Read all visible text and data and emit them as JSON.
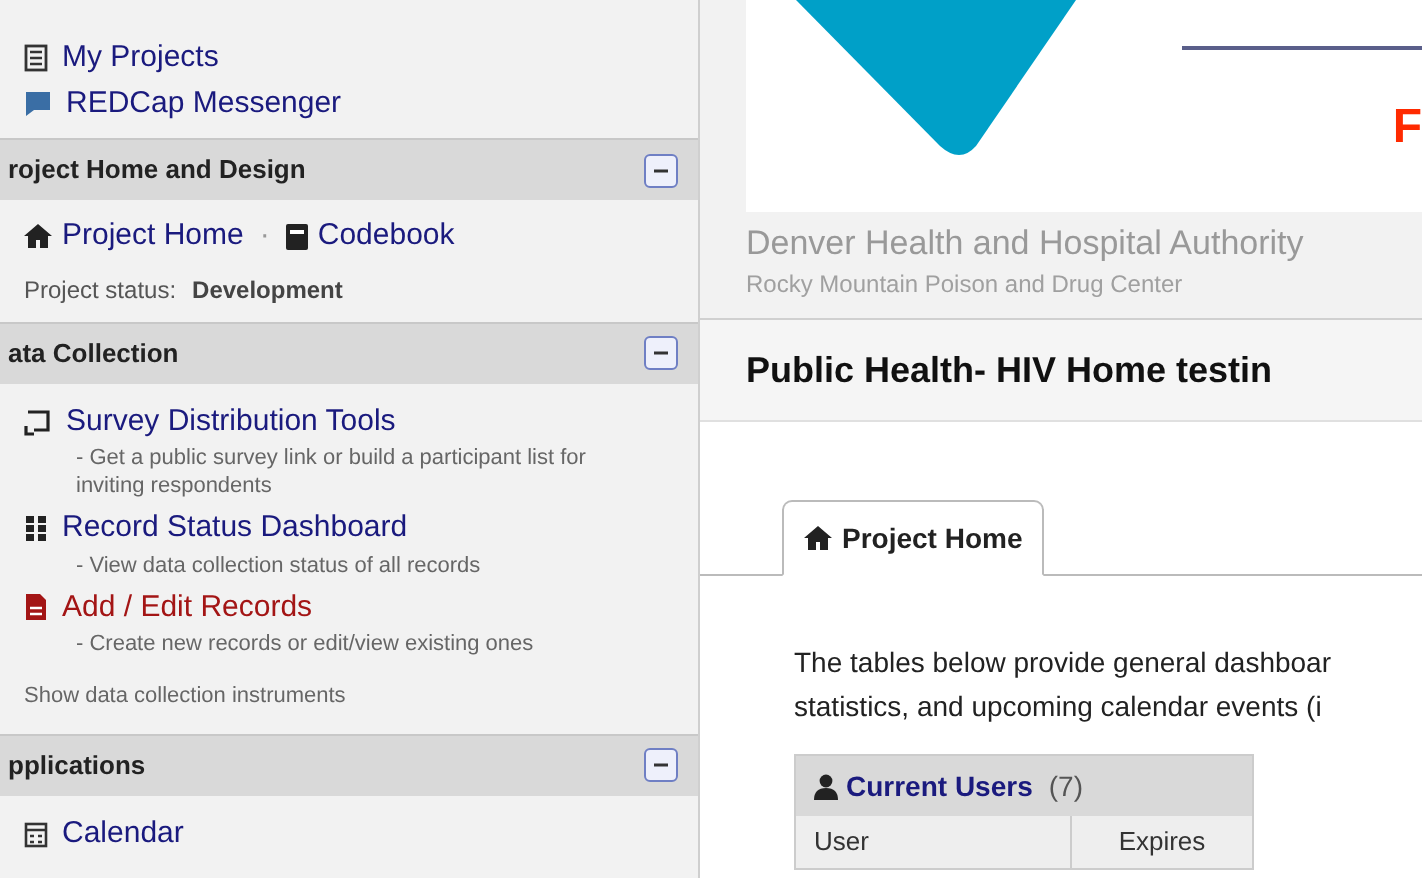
{
  "sidebar": {
    "top_links": [
      {
        "label": "My Projects",
        "kind": "list"
      },
      {
        "label": "REDCap Messenger",
        "kind": "chat"
      }
    ],
    "sections": [
      {
        "title": "roject Home and Design",
        "expanded": true,
        "kind": "home",
        "links": [
          "Project Home",
          "Codebook"
        ],
        "separator": "·",
        "status_label": "Project status:",
        "status_value": "Development"
      },
      {
        "title": "ata Collection",
        "expanded": true,
        "kind": "collection",
        "items": [
          {
            "label": "Survey Distribution Tools",
            "description": "- Get a public survey link or build a participant list for inviting respondents",
            "kind": "survey",
            "color": "#1a1a7e"
          },
          {
            "label": "Record Status Dashboard",
            "description": "- View data collection status of all records",
            "kind": "grid",
            "color": "#1a1a7e"
          },
          {
            "label": "Add / Edit Records",
            "description": "- Create new records or edit/view existing ones",
            "kind": "file",
            "color": "#a31515"
          }
        ],
        "footer": "Show data collection instruments"
      },
      {
        "title": "pplications",
        "expanded": true,
        "kind": "apps",
        "items": [
          {
            "label": "Calendar",
            "kind": "calendar"
          }
        ]
      }
    ]
  },
  "header": {
    "logo_letter": "F",
    "org": "Denver Health and Hospital Authority",
    "sub_org": "Rocky Mountain Poison and Drug Center",
    "project_title": "Public Health- HIV Home testin"
  },
  "tabs": [
    {
      "label": "Project Home",
      "selected": true
    }
  ],
  "intro": "The tables below provide general dashboar\nstatistics, and upcoming calendar events (i",
  "users_table": {
    "title": "Current Users",
    "count": "(7)",
    "columns": [
      "User",
      "Expires"
    ]
  }
}
